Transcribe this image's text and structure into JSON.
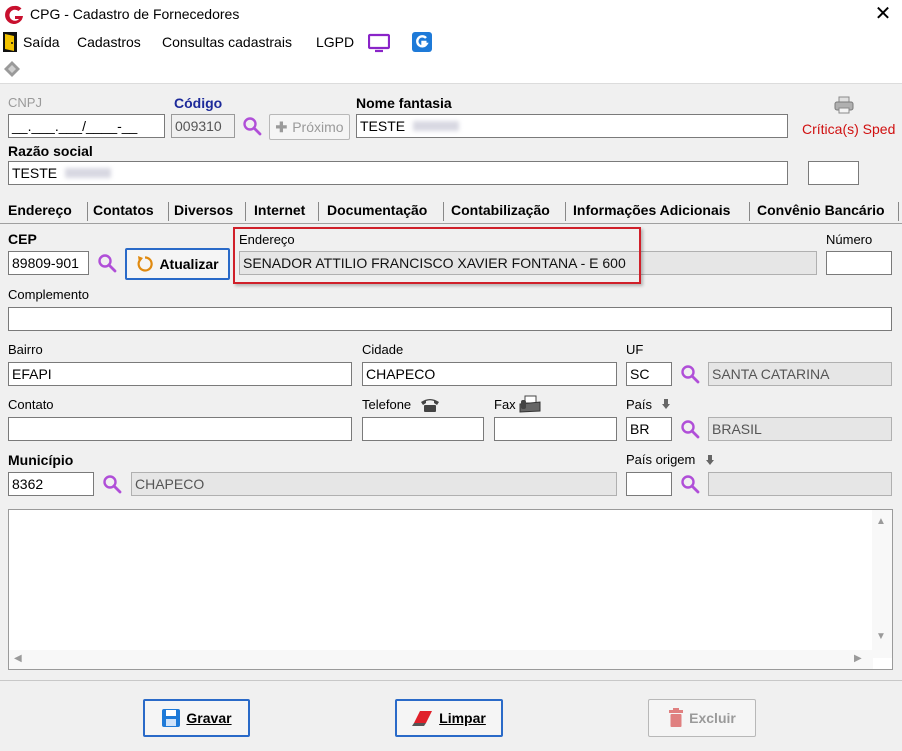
{
  "window": {
    "title": "CPG - Cadastro de Fornecedores"
  },
  "menu": {
    "items": [
      "Saída",
      "Cadastros",
      "Consultas cadastrais",
      "LGPD"
    ]
  },
  "header": {
    "cnpj_label": "CNPJ",
    "cnpj_value": "__.___.___/____-__",
    "codigo_label": "Código",
    "codigo_value": "009310",
    "proximo_label": "Próximo",
    "nome_fantasia_label": "Nome fantasia",
    "nome_fantasia_value": "TESTE",
    "critica_label": "Crítica(s) Sped",
    "razao_social_label": "Razão social",
    "razao_social_value": "TESTE"
  },
  "tabs": [
    "Endereço",
    "Contatos",
    "Diversos",
    "Internet",
    "Documentação",
    "Contabilização",
    "Informações Adicionais",
    "Convênio Bancário"
  ],
  "form": {
    "cep_label": "CEP",
    "cep_value": "89809-901",
    "atualizar_label": "Atualizar",
    "endereco_label": "Endereço",
    "endereco_value": "SENADOR ATTILIO FRANCISCO XAVIER FONTANA - E 600",
    "numero_label": "Número",
    "numero_value": "",
    "complemento_label": "Complemento",
    "complemento_value": "",
    "bairro_label": "Bairro",
    "bairro_value": "EFAPI",
    "cidade_label": "Cidade",
    "cidade_value": "CHAPECO",
    "uf_label": "UF",
    "uf_value": "SC",
    "uf_name": "SANTA CATARINA",
    "contato_label": "Contato",
    "contato_value": "",
    "telefone_label": "Telefone",
    "telefone_value": "",
    "fax_label": "Fax",
    "fax_value": "",
    "pais_label": "País",
    "pais_value": "BR",
    "pais_name": "BRASIL",
    "municipio_label": "Município",
    "municipio_value": "8362",
    "municipio_name": "CHAPECO",
    "pais_origem_label": "País origem",
    "pais_origem_value": "",
    "pais_origem_name": ""
  },
  "footer": {
    "gravar_label": "Gravar",
    "limpar_label": "Limpar",
    "excluir_label": "Excluir"
  },
  "colors": {
    "accent_blue": "#1d2a9a",
    "highlight_red": "#d0202a",
    "brand_red": "#c8102e",
    "critica_red": "#d01010"
  },
  "icons": [
    "app-logo-icon",
    "close-icon",
    "exit-door-icon",
    "monitor-icon",
    "brand-g-icon",
    "toolbar-diamond-icon",
    "search-icon",
    "refresh-icon",
    "phone-icon",
    "fax-icon",
    "down-arrow-icon",
    "save-icon",
    "eraser-icon",
    "trash-icon",
    "printer-icon"
  ]
}
